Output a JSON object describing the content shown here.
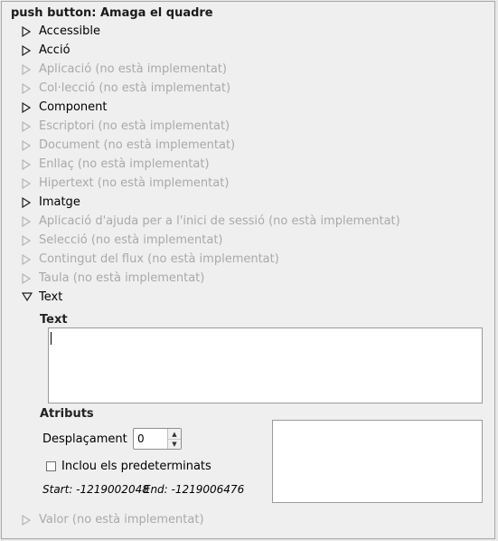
{
  "title": "push button: Amaga el quadre",
  "interfaces": [
    {
      "label": "Accessible",
      "enabled": true
    },
    {
      "label": "Acció",
      "enabled": true
    },
    {
      "label": "Aplicació (no està implementat)",
      "enabled": false
    },
    {
      "label": "Col·lecció (no està implementat)",
      "enabled": false
    },
    {
      "label": "Component",
      "enabled": true
    },
    {
      "label": "Escriptori (no està implementat)",
      "enabled": false
    },
    {
      "label": "Document (no està implementat)",
      "enabled": false
    },
    {
      "label": "Enllaç (no està implementat)",
      "enabled": false
    },
    {
      "label": "Hipertext (no està implementat)",
      "enabled": false
    },
    {
      "label": "Imatge",
      "enabled": true
    },
    {
      "label": "Aplicació d'ajuda per a l'inici de sessió (no està implementat)",
      "enabled": false
    },
    {
      "label": "Selecció (no està implementat)",
      "enabled": false
    },
    {
      "label": "Contingut del flux (no està implementat)",
      "enabled": false
    },
    {
      "label": "Taula (no està implementat)",
      "enabled": false
    },
    {
      "label": "Text",
      "enabled": true,
      "expanded": true
    }
  ],
  "text_section": {
    "text_heading": "Text",
    "text_value": "",
    "attributes_heading": "Atributs",
    "offset_label": "Desplaçament",
    "offset_value": "0",
    "include_defaults_label": "Inclou els predeterminats",
    "include_defaults_checked": false,
    "start_label": "Start: -1219002048",
    "end_label": "End: -1219006476"
  },
  "last_interface": {
    "label": "Valor (no està implementat)",
    "enabled": false
  },
  "icons": {
    "collapsed": "triangle-right-icon",
    "expanded": "triangle-down-icon"
  },
  "colors": {
    "disabled_text": "#a9a9a9",
    "background": "#efefef"
  }
}
